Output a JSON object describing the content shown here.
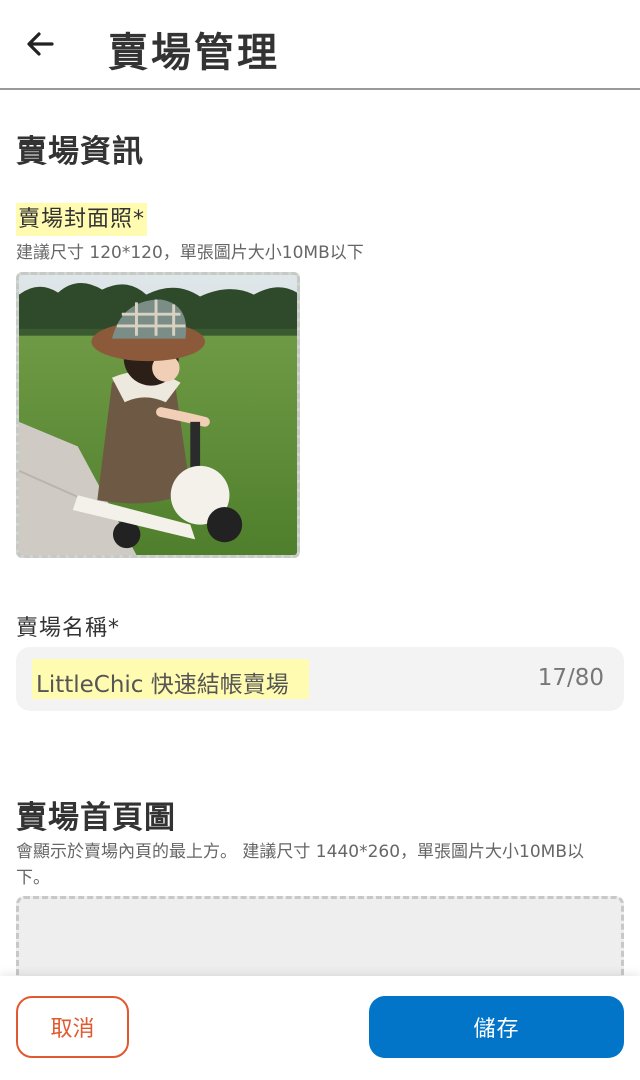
{
  "header": {
    "title": "賣場管理",
    "back_icon": "arrow-left-icon"
  },
  "store_info": {
    "section_title": "賣場資訊",
    "cover": {
      "label": "賣場封面照*",
      "hint": "建議尺寸 120*120，單張圖片大小10MB以下"
    },
    "name": {
      "label": "賣場名稱*",
      "value": "LittleChic 快速結帳賣場",
      "counter": "17/80"
    }
  },
  "homepage_image": {
    "section_title": "賣場首頁圖",
    "hint": "會顯示於賣場內頁的最上方。 建議尺寸 1440*260，單張圖片大小10MB以下。"
  },
  "footer": {
    "cancel_label": "取消",
    "save_label": "儲存"
  },
  "colors": {
    "highlight": "#fffbb0",
    "cancel": "#e2582f",
    "primary": "#0275c9"
  }
}
